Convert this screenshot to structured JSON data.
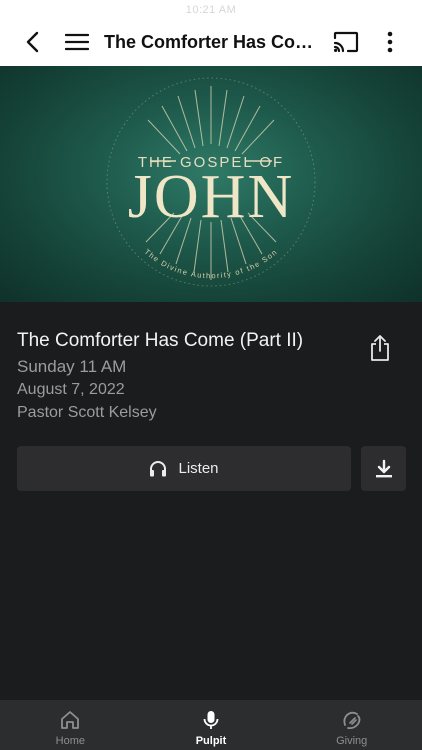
{
  "status_bar": {
    "time": "10:21 AM"
  },
  "top_bar": {
    "title": "The Comforter Has Come (Part II)"
  },
  "artwork": {
    "series_top": "THE GOSPEL OF",
    "series_title": "JOHN",
    "tagline": "The Divine Authority of the Son"
  },
  "sermon": {
    "title": "The Comforter Has Come (Part II)",
    "service": "Sunday 11 AM",
    "date": "August 7, 2022",
    "speaker": "Pastor Scott Kelsey"
  },
  "actions": {
    "listen_label": "Listen"
  },
  "tabs": [
    {
      "label": "Home",
      "icon": "home-icon",
      "active": false
    },
    {
      "label": "Pulpit",
      "icon": "microphone-icon",
      "active": true
    },
    {
      "label": "Giving",
      "icon": "giving-icon",
      "active": false
    }
  ],
  "colors": {
    "background": "#1b1c1e",
    "art_green": "#1e5a4c",
    "gold": "#e6dcc0"
  }
}
